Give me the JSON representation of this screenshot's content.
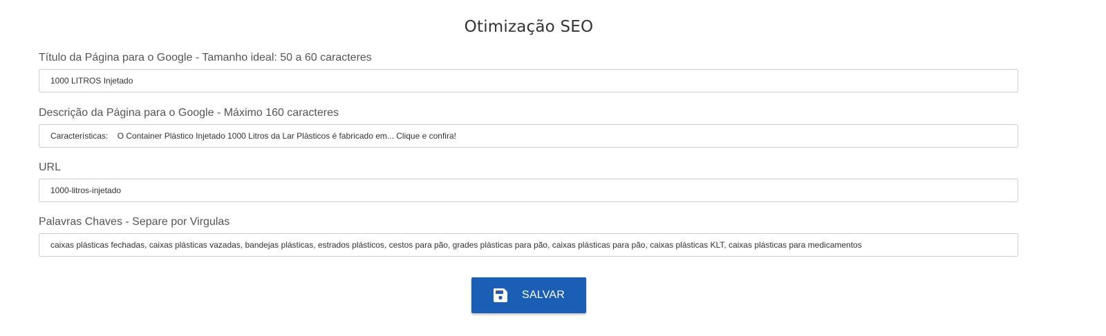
{
  "section": {
    "title": "Otimização SEO"
  },
  "fields": [
    {
      "label": "Título da Página para o Google - Tamanho ideal: 50 a 60 caracteres",
      "value": "1000 LITROS Injetado"
    },
    {
      "label": "Descrição da Página para o Google - Máximo 160 caracteres",
      "value": "Características:    O Container Plástico Injetado 1000 Litros da Lar Plásticos é fabricado em... Clique e confira!"
    },
    {
      "label": "URL",
      "value": "1000-litros-injetado"
    },
    {
      "label": "Palavras Chaves - Separe por Virgulas",
      "value": "caixas plásticas fechadas, caixas plásticas vazadas, bandejas plásticas, estrados plásticos, cestos para pão, grades plásticas para pão, caixas plásticas para pão, caixas plásticas KLT, caixas plásticas para medicamentos"
    }
  ],
  "actions": {
    "save_label": "SALVAR",
    "save_icon": "save-icon",
    "button_color": "#1b5eb5"
  }
}
